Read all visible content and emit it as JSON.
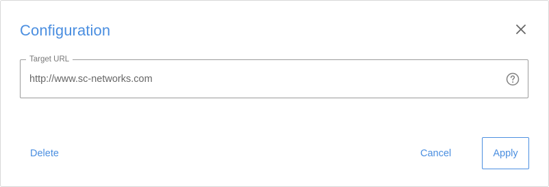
{
  "dialog": {
    "title": "Configuration",
    "close_icon": "close-icon"
  },
  "target_url": {
    "legend": "Target URL",
    "value": "http://www.sc-networks.com",
    "help_icon": "help-circle-icon"
  },
  "actions": {
    "delete_label": "Delete",
    "cancel_label": "Cancel",
    "apply_label": "Apply"
  },
  "colors": {
    "accent": "#4a8ee0",
    "border": "#9a9a9a",
    "icon": "#777777"
  }
}
